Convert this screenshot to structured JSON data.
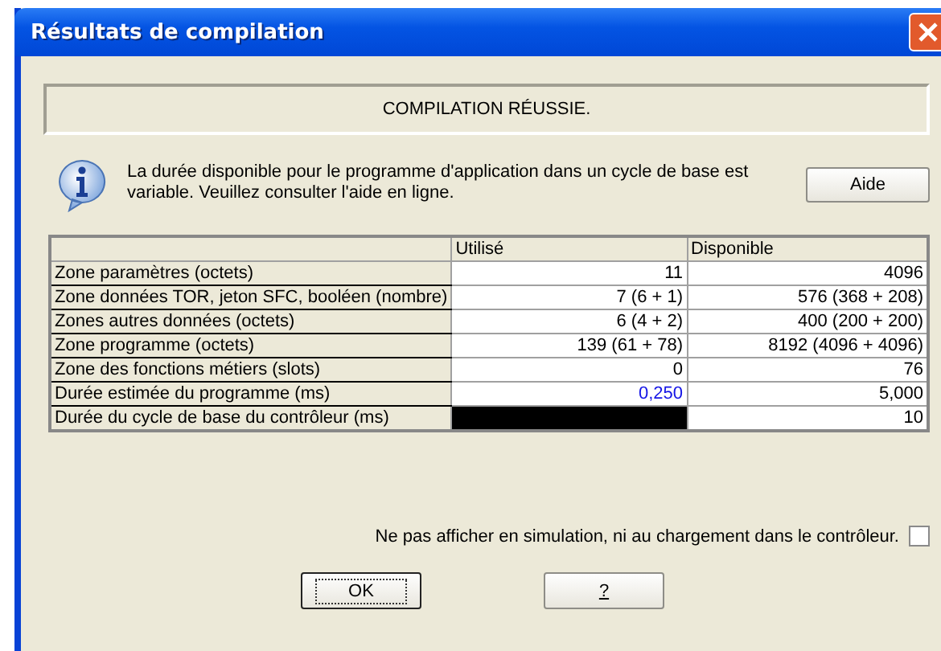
{
  "window": {
    "title": "Résultats de compilation"
  },
  "banner": "COMPILATION RÉUSSIE.",
  "info": {
    "text": "La durée disponible pour le programme d'application dans un cycle de base est variable. Veuillez consulter l'aide en ligne.",
    "button": "Aide"
  },
  "table": {
    "columns": [
      "Utilisé",
      "Disponible"
    ],
    "rows": [
      {
        "label": "Zone paramètres (octets)",
        "used": "11",
        "available": "4096",
        "emphasized": false,
        "masked": false
      },
      {
        "label": "Zone données TOR, jeton SFC, booléen (nombre)",
        "used": "7 (6 + 1)",
        "available": "576 (368 + 208)",
        "emphasized": false,
        "masked": false
      },
      {
        "label": "Zones autres données (octets)",
        "used": "6 (4 + 2)",
        "available": "400 (200 + 200)",
        "emphasized": false,
        "masked": false
      },
      {
        "label": "Zone programme (octets)",
        "used": "139 (61 + 78)",
        "available": "8192 (4096 + 4096)",
        "emphasized": false,
        "masked": false
      },
      {
        "label": "Zone des fonctions métiers (slots)",
        "used": "0",
        "available": "76",
        "emphasized": false,
        "masked": false
      },
      {
        "label": "Durée estimée du programme (ms)",
        "used": "0,250",
        "available": "5,000",
        "emphasized": true,
        "masked": false
      },
      {
        "label": "Durée du cycle de base du contrôleur (ms)",
        "available": "10",
        "emphasized": false,
        "masked": true
      }
    ]
  },
  "option": {
    "label": "Ne pas afficher en simulation, ni au chargement dans le contrôleur.",
    "checked": false
  },
  "buttons": [
    {
      "label": "OK",
      "default": true
    },
    {
      "label": "?",
      "default": false
    }
  ]
}
